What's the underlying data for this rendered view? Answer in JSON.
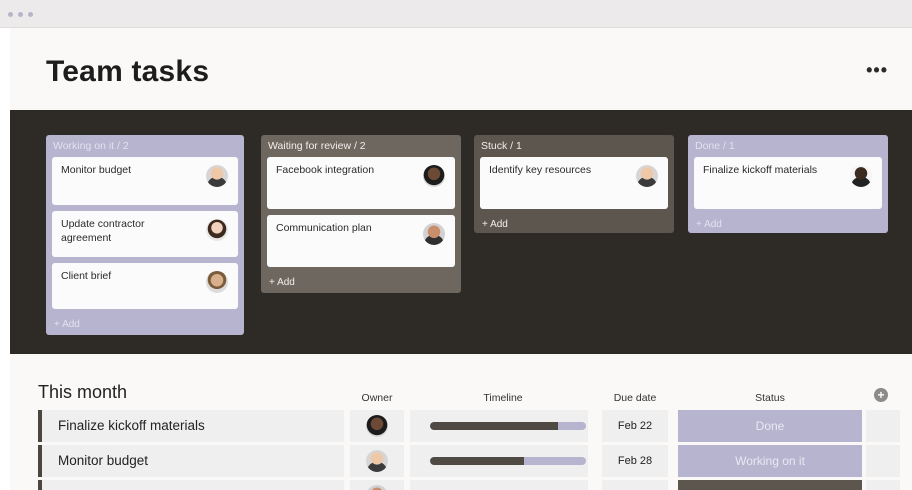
{
  "window": {
    "dots": [
      "window-dot",
      "window-dot",
      "window-dot"
    ]
  },
  "header": {
    "title": "Team tasks",
    "more_label": "•••"
  },
  "board": {
    "columns": [
      {
        "title": "Working on it / 2",
        "add_label": "+ Add",
        "color": "#b6b4ce",
        "cards": [
          {
            "label": "Monitor budget",
            "avatar": "person-avatar"
          },
          {
            "label": "Update contractor agreement",
            "avatar": "person-avatar"
          },
          {
            "label": "Client brief",
            "avatar": "person-avatar"
          }
        ]
      },
      {
        "title": "Waiting for review / 2",
        "add_label": "+ Add",
        "color": "#6e6760",
        "cards": [
          {
            "label": "Facebook integration",
            "avatar": "person-avatar"
          },
          {
            "label": "Communication plan",
            "avatar": "person-avatar"
          }
        ]
      },
      {
        "title": "Stuck / 1",
        "add_label": "+ Add",
        "color": "#5c564f",
        "cards": [
          {
            "label": "Identify key resources",
            "avatar": "person-avatar"
          }
        ]
      },
      {
        "title": "Done / 1",
        "add_label": "+ Add",
        "color": "#b6b4ce",
        "cards": [
          {
            "label": "Finalize kickoff materials",
            "avatar": "person-avatar"
          }
        ]
      }
    ]
  },
  "table": {
    "title": "This month",
    "headers": {
      "owner": "Owner",
      "timeline": "Timeline",
      "due": "Due date",
      "status": "Status"
    },
    "add_column_icon": "+",
    "rows": [
      {
        "name": "Finalize kickoff materials",
        "timeline_progress": 0.82,
        "due": "Feb 22",
        "status": "Done"
      },
      {
        "name": "Monitor budget",
        "timeline_progress": 0.6,
        "due": "Feb 28",
        "status": "Working on it"
      }
    ]
  },
  "colors": {
    "accent_lavender": "#b6b4ce",
    "board_background": "#2e2a25",
    "stuck": "#5c564f",
    "waiting": "#6e6760"
  }
}
